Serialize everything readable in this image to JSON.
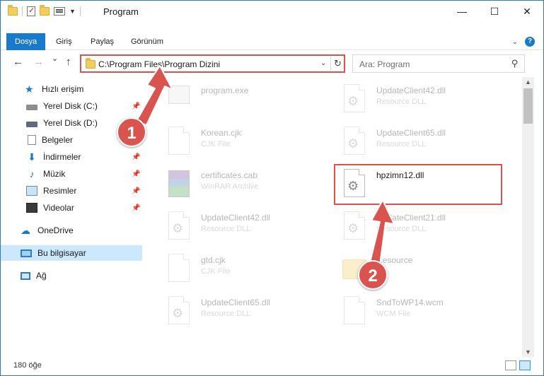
{
  "window": {
    "title": "Program",
    "minimize_glyph": "—",
    "maximize_glyph": "☐",
    "close_glyph": "✕"
  },
  "ribbon": {
    "tabs": [
      "Dosya",
      "Giriş",
      "Paylaş",
      "Görünüm"
    ],
    "active_tab": "Dosya",
    "help_glyph": "?"
  },
  "navigation": {
    "back_glyph": "←",
    "forward_glyph": "→",
    "history_glyph": "⌄",
    "up_glyph": "↑",
    "address": "C:\\Program Files\\Program Dizini",
    "search_placeholder": "Ara: Program"
  },
  "sidebar": {
    "items": [
      {
        "label": "Hızlı erişim",
        "icon": "star-icon"
      },
      {
        "label": "Yerel Disk (C:)",
        "icon": "drive-icon",
        "pinned": true
      },
      {
        "label": "Yerel Disk (D:)",
        "icon": "drive-icon",
        "pinned": true
      },
      {
        "label": "Belgeler",
        "icon": "document-icon",
        "pinned": true
      },
      {
        "label": "İndirmeler",
        "icon": "download-icon",
        "pinned": true
      },
      {
        "label": "Müzik",
        "icon": "music-icon",
        "pinned": true
      },
      {
        "label": "Resimler",
        "icon": "pictures-icon",
        "pinned": true
      },
      {
        "label": "Videolar",
        "icon": "video-icon",
        "pinned": true
      },
      {
        "label": "OneDrive",
        "icon": "cloud-icon"
      },
      {
        "label": "Bu bilgisayar",
        "icon": "computer-icon",
        "selected": true
      },
      {
        "label": "Ağ",
        "icon": "network-icon"
      }
    ]
  },
  "files": [
    {
      "name": "program.exe",
      "type": "",
      "icon": "exe-icon"
    },
    {
      "name": "UpdateClient42.dll",
      "type": "Resource DLL",
      "icon": "dll-icon"
    },
    {
      "name": "Korean.cjk",
      "type": "CJK File",
      "icon": "file-icon"
    },
    {
      "name": "UpdateClient65.dll",
      "type": "Resource DLL",
      "icon": "dll-icon"
    },
    {
      "name": "certificates.cab",
      "type": "WinRAR Archive",
      "icon": "archive-icon"
    },
    {
      "name": "hpzimn12.dll",
      "type": "",
      "icon": "dll-icon",
      "highlighted": true
    },
    {
      "name": "UpdateClient42.dll",
      "type": "Resource DLL",
      "icon": "dll-icon"
    },
    {
      "name": "UpdateClient21.dll",
      "type": "Resource DLL",
      "icon": "dll-icon"
    },
    {
      "name": "gtd.cjk",
      "type": "CJK File",
      "icon": "file-icon"
    },
    {
      "name": "Resource",
      "type": "",
      "icon": "folder-icon"
    },
    {
      "name": "UpdateClient65.dll",
      "type": "Resource DLL",
      "icon": "dll-icon"
    },
    {
      "name": "SndToWP14.wcm",
      "type": "WCM File",
      "icon": "file-icon"
    }
  ],
  "status": {
    "item_count": "180 öğe"
  },
  "annotations": {
    "step1_label": "1",
    "step2_label": "2",
    "color": "#d9534f"
  },
  "colors": {
    "accent": "#1979ca",
    "selection": "#cce8ff",
    "highlight_border": "#d9534f"
  }
}
